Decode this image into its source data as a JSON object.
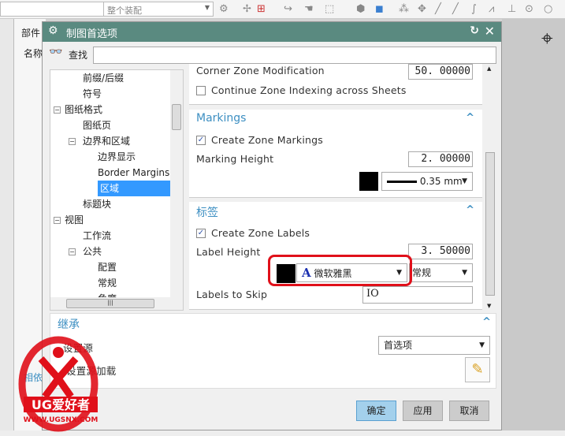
{
  "toolbar": {
    "left_combo": "",
    "assembly_combo": "整个装配"
  },
  "nav": {
    "tab_parts": "部件",
    "col_name": "名称",
    "related": "相依"
  },
  "dialog": {
    "title": "制图首选项",
    "find_label": "查找",
    "find_value": "",
    "tree": [
      {
        "label": "前缀/后缀",
        "level": 2
      },
      {
        "label": "符号",
        "level": 2
      },
      {
        "label": "图纸格式",
        "level": 1,
        "expanded": true
      },
      {
        "label": "图纸页",
        "level": 2
      },
      {
        "label": "边界和区域",
        "level": 2,
        "expanded": true
      },
      {
        "label": "边界显示",
        "level": 3
      },
      {
        "label": "Border Margins",
        "level": 3
      },
      {
        "label": "区域",
        "level": 3,
        "selected": true
      },
      {
        "label": "标题块",
        "level": 2
      },
      {
        "label": "视图",
        "level": 1,
        "expanded": true
      },
      {
        "label": "工作流",
        "level": 2
      },
      {
        "label": "公共",
        "level": 2,
        "expanded": true
      },
      {
        "label": "配置",
        "level": 3
      },
      {
        "label": "常规",
        "level": 3
      },
      {
        "label": "角度",
        "level": 3
      }
    ],
    "zone": {
      "corner_label": "Corner Zone Modification",
      "corner_value": "50. 00000",
      "continue_label": "Continue Zone Indexing across Sheets",
      "continue_checked": false
    },
    "markings": {
      "title": "Markings",
      "create_label": "Create Zone Markings",
      "create_checked": true,
      "height_label": "Marking Height",
      "height_value": "2. 00000",
      "color": "#000000",
      "line_width": "0.35 mm"
    },
    "labels": {
      "title": "标签",
      "create_label": "Create Zone Labels",
      "create_checked": true,
      "height_label": "Label Height",
      "height_value": "3. 50000",
      "color": "#000000",
      "font_icon": "A",
      "font": "微软雅黑",
      "style": "常规",
      "skip_label": "Labels to Skip",
      "skip_value": "IO"
    },
    "inherit": {
      "title": "继承",
      "source_label": "设置源",
      "source_value": "首选项",
      "load_label": "设置源加载"
    },
    "buttons": {
      "ok": "确定",
      "apply": "应用",
      "cancel": "取消"
    },
    "highlight_color": "#e0101a"
  },
  "watermark": {
    "brand": "UG爱好者",
    "url": "WWW.UGSNX.COM",
    "color": "#e0101a"
  }
}
